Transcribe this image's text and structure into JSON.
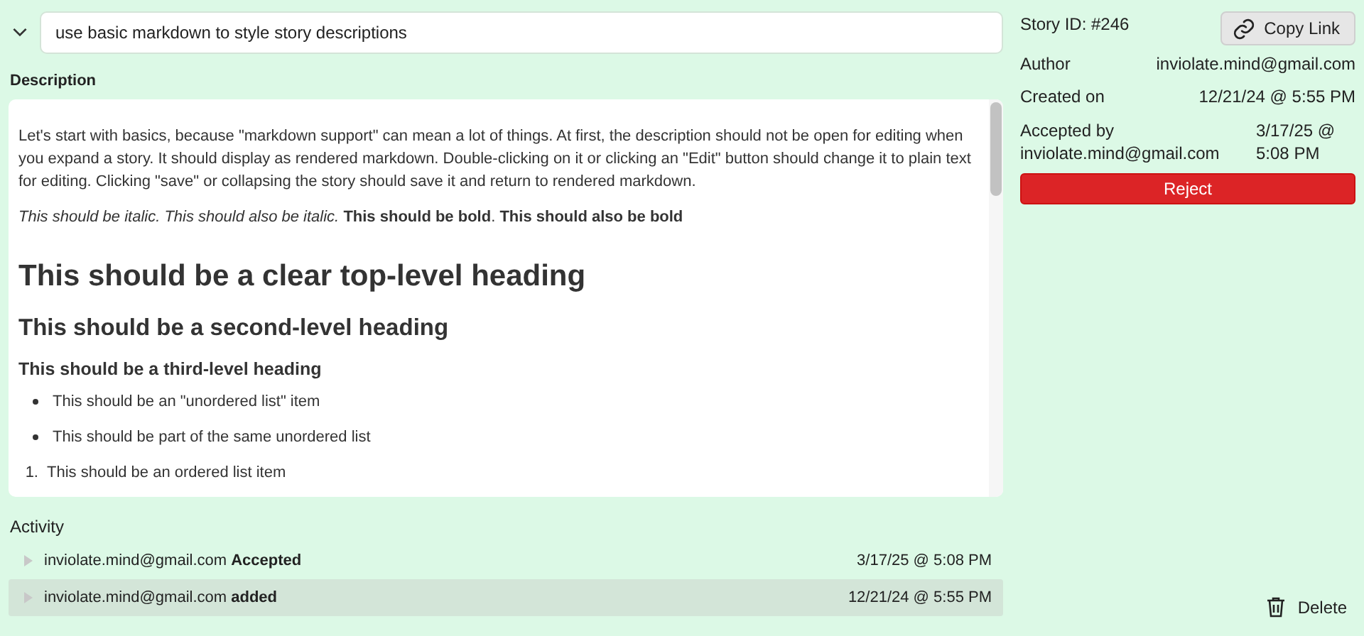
{
  "story": {
    "expanded": true,
    "title": "use basic markdown to style story descriptions"
  },
  "description": {
    "label": "Description",
    "blocks": [
      {
        "kind": "paragraph",
        "text": "Let's start with basics, because \"markdown support\" can mean a lot of things. At first, the description should not be open for editing when you expand a story. It should display as rendered markdown. Double-clicking on it or clicking an \"Edit\" button should change it to plain text for editing. Clicking \"save\" or collapsing the story should save it and return to rendered markdown."
      },
      {
        "kind": "paragraph",
        "text": "*This should be italic. This should also be italic.* **This should be bold**. **This should also be bold**"
      },
      {
        "kind": "heading1",
        "text": "This should be a clear top-level heading"
      },
      {
        "kind": "heading2",
        "text": "This should be a second-level heading"
      },
      {
        "kind": "heading3",
        "text": "This should be a third-level heading"
      },
      {
        "kind": "bullet",
        "text": "This should be an \"unordered list\" item"
      },
      {
        "kind": "bullet",
        "text": "This should be part of the same unordered list"
      },
      {
        "kind": "ordered",
        "marker": "1.",
        "text": "This should be an ordered list item"
      }
    ]
  },
  "activity": {
    "label": "Activity",
    "rows": [
      {
        "text": "inviolate.mind@gmail.com **Accepted**",
        "time": "3/17/25 @ 5:08 PM",
        "selected": false
      },
      {
        "text": "inviolate.mind@gmail.com **added**",
        "time": "12/21/24 @ 5:55 PM",
        "selected": true
      }
    ]
  },
  "details": {
    "story_id": "Story ID: #246",
    "copy_link": "Copy Link",
    "fields": [
      {
        "label": "Author",
        "value": "inviolate.mind@gmail.com"
      },
      {
        "label": "Created on",
        "value": "12/21/24 @ 5:55 PM"
      }
    ],
    "accepted": {
      "label": "Accepted by inviolate.mind@gmail.com",
      "value": "3/17/25 @ 5:08 PM"
    },
    "reject": "Reject",
    "delete": "Delete"
  }
}
